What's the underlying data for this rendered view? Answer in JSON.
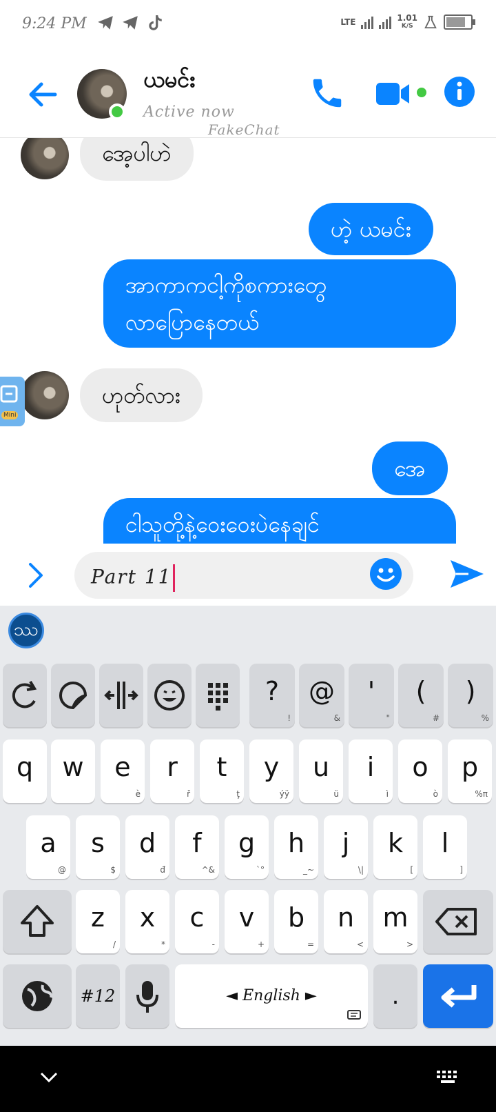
{
  "status_bar": {
    "time": "9:24 PM",
    "net_label": "LTE",
    "speed_value": "1.01",
    "speed_unit": "K/S"
  },
  "header": {
    "contact_name": "ယမင်း",
    "presence": "Active now",
    "watermark": "FakeChat"
  },
  "messages": [
    {
      "dir": "in",
      "lines": [
        "အေ့ပါဟဲ"
      ]
    },
    {
      "dir": "out",
      "lines": [
        "ဟဲ့ ယမင်း"
      ]
    },
    {
      "dir": "out",
      "lines": [
        "အာကာကငါ့ကိုစကားတွေ",
        "လာပြောနေတယ်"
      ]
    },
    {
      "dir": "in",
      "lines": [
        "ဟုတ်လား"
      ]
    },
    {
      "dir": "out",
      "lines": [
        "အေ"
      ]
    },
    {
      "dir": "out",
      "lines": [
        "ငါသူတို့နဲ့ဝေးဝေးပဲနေချင်"
      ]
    }
  ],
  "floating_tool": {
    "badge": "Mini"
  },
  "composer": {
    "text": "Part 11"
  },
  "keyboard": {
    "logo_glyph": "ဿ",
    "symbol_row": [
      {
        "icon": "refresh-icon"
      },
      {
        "icon": "sticker-icon"
      },
      {
        "icon": "cursor-move-icon"
      },
      {
        "icon": "emoji-icon"
      },
      {
        "icon": "numpad-icon"
      },
      {
        "main": "?",
        "sub": "!"
      },
      {
        "main": "@",
        "sub": "&"
      },
      {
        "main": "'",
        "sub": "\""
      },
      {
        "main": "(",
        "sub": "#"
      },
      {
        "main": ")",
        "sub": "%"
      }
    ],
    "row1": [
      {
        "main": "q",
        "sub": ""
      },
      {
        "main": "w",
        "sub": ""
      },
      {
        "main": "e",
        "sub": "è"
      },
      {
        "main": "r",
        "sub": "ř"
      },
      {
        "main": "t",
        "sub": "ţ"
      },
      {
        "main": "y",
        "sub": "ýÿ"
      },
      {
        "main": "u",
        "sub": "ü"
      },
      {
        "main": "i",
        "sub": "ì"
      },
      {
        "main": "o",
        "sub": "ò"
      },
      {
        "main": "p",
        "sub": "%π"
      }
    ],
    "row2": [
      {
        "main": "a",
        "sub": "@"
      },
      {
        "main": "s",
        "sub": "$"
      },
      {
        "main": "d",
        "sub": "đ"
      },
      {
        "main": "f",
        "sub": "^&"
      },
      {
        "main": "g",
        "sub": "`°"
      },
      {
        "main": "h",
        "sub": "_~"
      },
      {
        "main": "j",
        "sub": "\\|"
      },
      {
        "main": "k",
        "sub": "["
      },
      {
        "main": "l",
        "sub": "]"
      }
    ],
    "row3": [
      {
        "main": "z",
        "sub": "/"
      },
      {
        "main": "x",
        "sub": "*"
      },
      {
        "main": "c",
        "sub": "-"
      },
      {
        "main": "v",
        "sub": "+"
      },
      {
        "main": "b",
        "sub": "="
      },
      {
        "main": "n",
        "sub": "<"
      },
      {
        "main": "m",
        "sub": ">"
      }
    ],
    "numbers_key": "#12",
    "space_label": "◄ English ►",
    "period": "."
  },
  "colors": {
    "accent": "#0a84ff",
    "online": "#43c943",
    "enter": "#1a73e8",
    "keyboard_bg": "#e8eaed"
  }
}
